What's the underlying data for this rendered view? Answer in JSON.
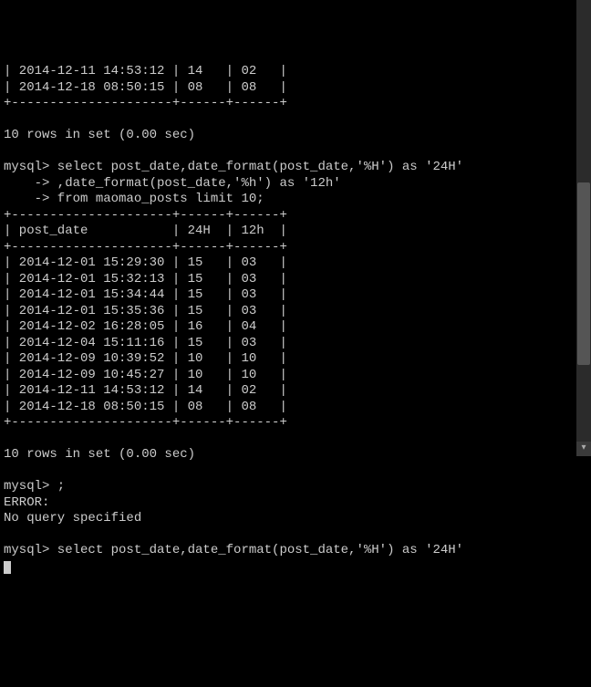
{
  "partial_table_tail": {
    "rows": [
      {
        "post_date": "2014-12-11 14:53:12",
        "c24": "14",
        "c12": "02"
      },
      {
        "post_date": "2014-12-18 08:50:15",
        "c24": "08",
        "c12": "08"
      }
    ]
  },
  "summary_top": "10 rows in set (0.00 sec)",
  "prompt1": "mysql>",
  "cont": "    ->",
  "query_line1": "select post_date,date_format(post_date,'%H') as '24H'",
  "query_line2": ",date_format(post_date,'%h') as '12h'",
  "query_line3": "from maomao_posts limit 10;",
  "table_border_top": "+---------------------+------+------+",
  "table_header": {
    "col1": "post_date",
    "col2": "24H",
    "col3": "12h"
  },
  "table_rows": [
    {
      "post_date": "2014-12-01 15:29:30",
      "c24": "15",
      "c12": "03"
    },
    {
      "post_date": "2014-12-01 15:32:13",
      "c24": "15",
      "c12": "03"
    },
    {
      "post_date": "2014-12-01 15:34:44",
      "c24": "15",
      "c12": "03"
    },
    {
      "post_date": "2014-12-01 15:35:36",
      "c24": "15",
      "c12": "03"
    },
    {
      "post_date": "2014-12-02 16:28:05",
      "c24": "16",
      "c12": "04"
    },
    {
      "post_date": "2014-12-04 15:11:16",
      "c24": "15",
      "c12": "03"
    },
    {
      "post_date": "2014-12-09 10:39:52",
      "c24": "10",
      "c12": "10"
    },
    {
      "post_date": "2014-12-09 10:45:27",
      "c24": "10",
      "c12": "10"
    },
    {
      "post_date": "2014-12-11 14:53:12",
      "c24": "14",
      "c12": "02"
    },
    {
      "post_date": "2014-12-18 08:50:15",
      "c24": "08",
      "c12": "08"
    }
  ],
  "summary_bottom": "10 rows in set (0.00 sec)",
  "semicolon": ";",
  "error_label": "ERROR:",
  "error_msg": "No query specified",
  "query2_line1": "select post_date,date_format(post_date,'%H') as '24H'"
}
